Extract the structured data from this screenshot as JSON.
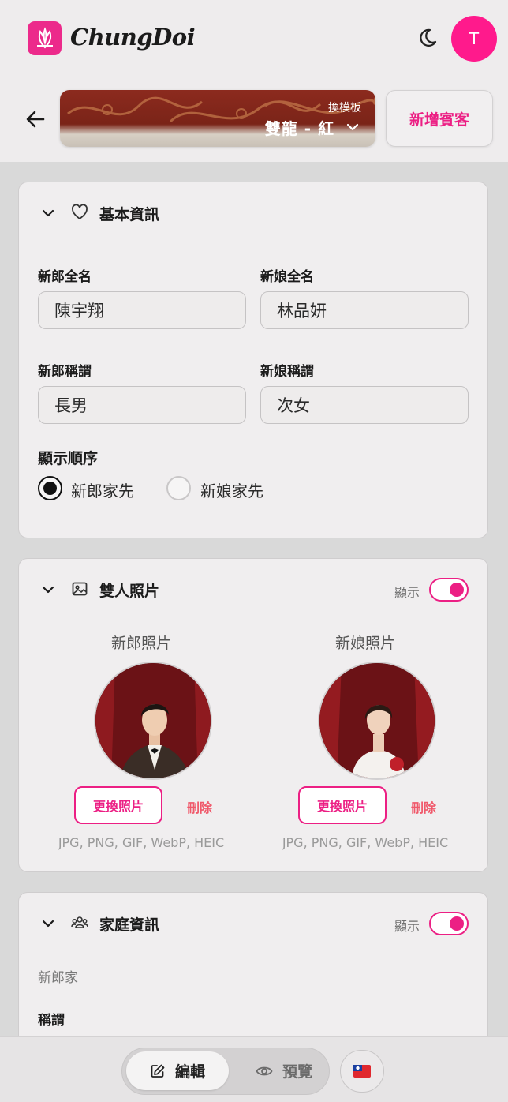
{
  "app": {
    "name": "ChungDoi",
    "avatar_initial": "T"
  },
  "colors": {
    "accent": "#ec1f84",
    "delete": "#f0586a"
  },
  "icons": {
    "logo": "flower-logo-icon",
    "theme": "moon-icon",
    "back": "arrow-left-icon",
    "dropdown": "chevron-down-icon"
  },
  "template": {
    "switch_label": "換模板",
    "name": "雙龍 - 紅"
  },
  "header": {
    "add_guest_label": "新增賓客"
  },
  "basic_info": {
    "title": "基本資訊",
    "groom_name_label": "新郎全名",
    "groom_name_value": "陳宇翔",
    "bride_name_label": "新娘全名",
    "bride_name_value": "林品妍",
    "groom_title_label": "新郎稱謂",
    "groom_title_value": "長男",
    "bride_title_label": "新娘稱謂",
    "bride_title_value": "次女",
    "order_label": "顯示順序",
    "order_options": [
      "新郎家先",
      "新娘家先"
    ],
    "order_selected": "新郎家先"
  },
  "couple_photos": {
    "title": "雙人照片",
    "show_label": "顯示",
    "show_on": true,
    "groom_photo_label": "新郎照片",
    "bride_photo_label": "新娘照片",
    "change_label": "更換照片",
    "delete_label": "刪除",
    "formats": "JPG, PNG, GIF, WebP, HEIC"
  },
  "family_info": {
    "title": "家庭資訊",
    "show_label": "顯示",
    "show_on": true,
    "groom_family_label": "新郎家",
    "title_field_label": "稱謂"
  },
  "bottom_nav": {
    "edit_label": "編輯",
    "preview_label": "預覽",
    "language_flag": "taiwan-flag-icon"
  }
}
